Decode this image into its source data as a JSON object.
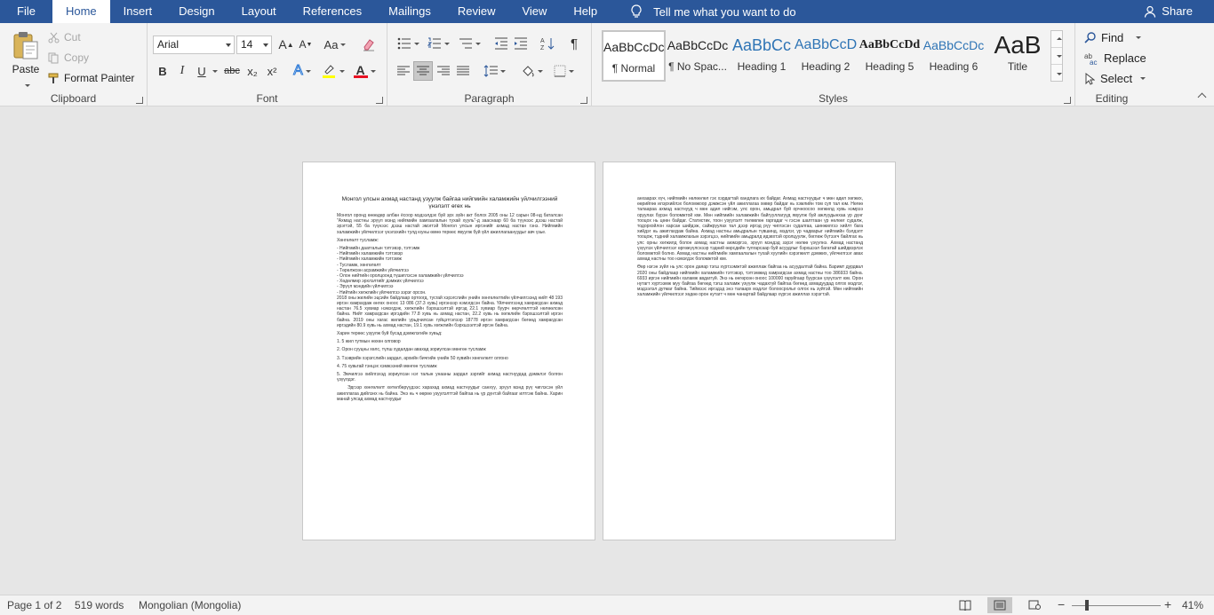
{
  "menu": {
    "tabs": [
      {
        "label": "File"
      },
      {
        "label": "Home"
      },
      {
        "label": "Insert"
      },
      {
        "label": "Design"
      },
      {
        "label": "Layout"
      },
      {
        "label": "References"
      },
      {
        "label": "Mailings"
      },
      {
        "label": "Review"
      },
      {
        "label": "View"
      },
      {
        "label": "Help"
      }
    ],
    "tell_me": "Tell me what you want to do",
    "share": "Share"
  },
  "clipboard": {
    "paste": "Paste",
    "cut": "Cut",
    "copy": "Copy",
    "format_painter": "Format Painter",
    "label": "Clipboard"
  },
  "font": {
    "name": "Arial",
    "size": "14",
    "label": "Font",
    "bold": "B",
    "italic": "I",
    "underline": "U",
    "strike": "abc",
    "subscript": "x₂",
    "superscript": "x²",
    "grow": "A",
    "shrink": "A",
    "case": "Aa",
    "text_effects": "A",
    "font_color": "A",
    "highlight_color": "#ffff00",
    "font_color_value": "#e81123"
  },
  "paragraph": {
    "label": "Paragraph",
    "pilcrow": "¶"
  },
  "styles": {
    "label": "Styles",
    "items": [
      {
        "preview": "AaBbCcDc",
        "name": "¶ Normal"
      },
      {
        "preview": "AaBbCcDc",
        "name": "¶ No Spac..."
      },
      {
        "preview": "AaBbCc",
        "name": "Heading 1"
      },
      {
        "preview": "AaBbCcD",
        "name": "Heading 2"
      },
      {
        "preview": "AaBbCcDd",
        "name": "Heading 5"
      },
      {
        "preview": "AaBbCcDc",
        "name": "Heading 6"
      },
      {
        "preview": "AaB",
        "name": "Title"
      }
    ]
  },
  "editing": {
    "label": "Editing",
    "find": "Find",
    "replace": "Replace",
    "select": "Select"
  },
  "document": {
    "page1": {
      "title": "Монгол улсын ахмад настанд узуулж байгаа нийгмийн халамжийн үйлчилгээний үнэлэлт өгөх нь",
      "intro": "Монгол оронд өнөөдөр албан ёсоор мэдээлдэх буй эрх зүйн акт болох 2005 оны 12 сарын 08-нд баталсан \"Ахмад настны эрүүл мэнд нийгмийн хамгаалалын тухай хууль\"-д зааснаар 60 ба түүнээс дээш настай эрэгтэй, 55 ба түүнээс дээш настай эмэгтэй Монгол улсын иргэнийг ахмад настан гэнэ. Нийгмийн халамжийн үйлчилгээг үнэлэхийн тулд юуны өмнө терөөс явуулж буй үйл ажиллагаануудыг авч үзье.",
      "list_head": "Хөнгөлөлт тусламж:",
      "list": [
        "- Нийгмийн даатгалын тэтгэвэр, тэтгэмж",
        "- Нийгмийн халамжийн тэтгэвэр",
        "- Нийгмийн халамжийн тэтгэмж",
        "- Тусламж, хөнгөлөлт",
        "- Төрөлжсөн асрамжийн үйлчилгээ",
        "- Олон нийтийн оролцоонд түшиглэсэн халамжийн үйлчилгээ",
        "- Хөдөлмөр эрхлэлтийг дэмжих үйлчилгээ",
        "- Эрүүл мэндийн үйлчилгээ",
        "- Нийтийн хөгжлийн үйлчилгээ зэрэг орсон."
      ],
      "stats": "2018 оны жилийн эцсийн байдлаар ортоогд, тусгай хэрэгслийн үнийн хөнгөлөлтийн үйлчилгээнд нийт 48 193 иргэн хамрагдаж өнгөх оноос 13 086 (37.3 хувь) иргэнээр нэмэгдсэн байна. Үйлчилгээнд хамрагдсан ахмад настан 76.5 хувиар нэмэгдэж, хөгжлийн бэрхшээлтэй иргэд 22.1 хувиар буурч өөрчлөлттэй нөлөөлсөн байна. Нийт хамрагдсан иргэдийн 77.8 хувь нь ахмад настан, 22.2 хувь нь хөгжлийн бэрхшээлтэй иргэн байна. 2019 оны хагас жилийн үрьдчилсан гүйцэтгэлээр 18778 иргэн хамрагдсан бөгөөд хамрагдсан иргэдийн 80.9 хувь нь ахмад настан, 19.1 хувь хөгжлийн бэрхшээлтэй иргэн байна.",
      "programs_head": "Харин терөөс узуулж буй бусад дэмжлэгийн хувьд:",
      "programs": [
        "1. 5 жил тутмын нөхөн олговор",
        "2. Орон сууцны хөлс, түлш худалдан авахад зориулсан мөнгөн тусламж",
        "3. Тээврийн хэрэгслийн зардал, архийн бичгийн үнийн 50 хувийн хөнгөлөлт олгоно",
        "4. 75 хувьтай тэнцэх хэмжээний мөнгөн тусламж",
        "5. Эмчилгээ хийлгэхэд зориулсан нэг талын унааны зардал зэргийг ахмад настнуудад дэмжлэг болгон үзүүлдэг."
      ],
      "closing": "Эдгээр хөнгөлөлт хөтөлбөрүүдээс харахад ахмад настнуудыг санхүү, эрүүл мэнд рүү чиглэсэн үйл ажиллагаа дийлэнх нь байна. Энэ нь ч өөрөө узуулэлттэй байгаа нь үр дүнтэй байгааг илтгэж байна. Харин манай улсад ахмад настнуудыг"
    },
    "page2": {
      "para1": "анхаарах хүч, нийгмийн нөлөөлөл гэх хэрдагтай хандлага их байдаг. Ахмад настнуудыг ч мөн адил хөгжих, өөрийгөө илэрхийлэх боломжоор дэмжсэн үйл ажиллагаа хөвөр байдаг нь хэмлийн том суп тал юм. Нөгөө талаараа ахмад настнууд ч мөн адил нийгэм, улс орон, амьдрал буй орчноосоо хөгжилд хувь нэмрээ оруулах бүрэн боломжтой юм. Мөн нийгмийн халамжийн байгууллагууд явуулж буй ажлуудынхаа үр дүнг тооцох нь цөөн байдаг. Статистик, тоон узуулэлт төлөвлөн гаргадаг ч гэсэн шалтгаан үр нөлөөг судалж, тодорхойлон харсан шийдэж, сайжруулах тал дээр иргэд рүү чиглэсэн судалгаа, шинжилгээ хийлт бага хийдэг нь ажиглагдаж байна. Ахмад настны амьдралын түвшинд, мэдлэг, үр чадварыг нийгмийн бэлдэлт тооцож, тэдний халамжлахын зэрэгцээ, нийгмийн амьдралд идэвхтэй оролцуулж, бөглөж бүтээгч байлгах нь улс орны хөгжилд болон ахмад настны аюмэргээ, эрүүл мэндэд зэрэг нөлөө үзүүлнэ. Ахмад настанд үзүүлэх үйлчилгээг өргөжүүлснээр тэдний өөрсдийн тулгарсаар буй асуудлыг бэрхшээл багатай шийдвэрлэх боломжтой болно. Ахмад настны нийгмийн хамгаалалын тухай хуулийн хэрэгжилт дэмжих, үйлчилгээг авах ахмад настны тоо нэмэгдэх боломжтой юм.",
      "para2": "Өөр нэгэн зүйл нь улс орон даяар тэгш хүртээмжтэй ажиллаж байгаа нь асуудалтай байна. Баримт дурдвал 2020 оны байдлаар нийгмийн халамжийн тэтгэвэр, тэтгэмжид хамрагдсан ахмад настны тоо 386933 байна. 6933 иргэн нийгмийн халамж авдаггүй. Энэ нь өнгөрсөн оноос 100000 гаруйгаар буурсан үзүүлэлт юм. Орон нутагт хүртээмж муу байгаа бөгөөд тэгш халамж үзүүлж чадахгүй байгаа бөгөөд ахмадуудад олгох мэдлэг, мэдээлэл дутмаг байна. Тиймээс иргэдэд энэ талаарх мэдлэг болоосролыг олгох нь зүйтэй. Мөн нийгмийн халамжийн үйлчилгээг хөдөө орон нутагт ч мөн чанартай байдлаар хүргэх ажиллах хэрэгтэй."
    }
  },
  "status": {
    "page": "Page 1 of 2",
    "words": "519 words",
    "language": "Mongolian (Mongolia)",
    "zoom": "41%",
    "zoom_level_percent": 41
  }
}
